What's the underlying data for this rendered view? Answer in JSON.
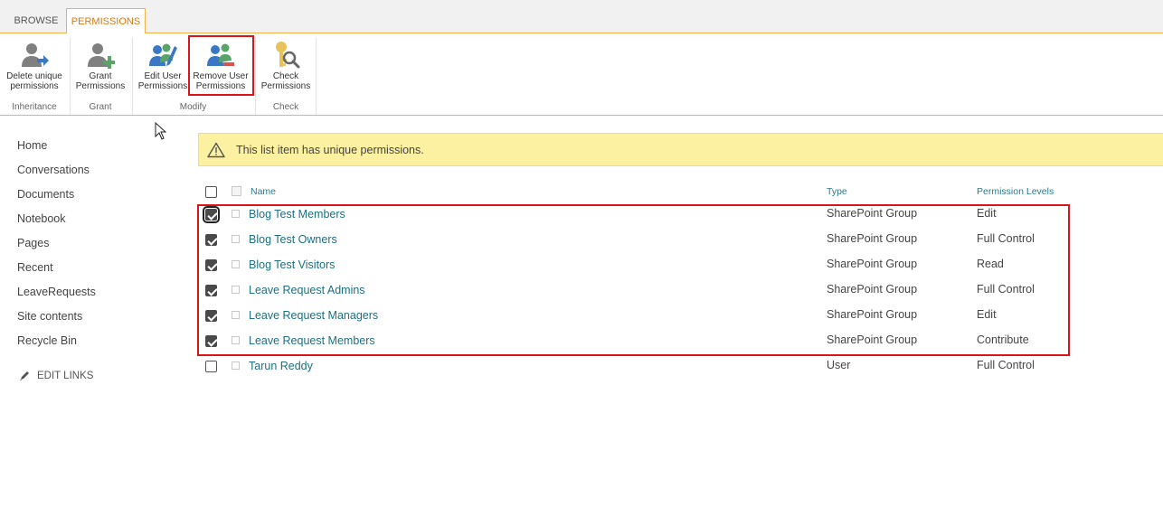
{
  "tabs": [
    {
      "label": "BROWSE",
      "active": false
    },
    {
      "label": "PERMISSIONS",
      "active": true
    }
  ],
  "ribbon": {
    "buttons": {
      "delete_unique": {
        "line1": "Delete unique",
        "line2": "permissions",
        "icon": "user-arrow-icon"
      },
      "grant": {
        "line1": "Grant",
        "line2": "Permissions",
        "icon": "user-add-icon"
      },
      "edit_user": {
        "line1": "Edit User",
        "line2": "Permissions",
        "icon": "users-edit-icon"
      },
      "remove_user": {
        "line1": "Remove User",
        "line2": "Permissions",
        "icon": "users-remove-icon"
      },
      "check": {
        "line1": "Check",
        "line2": "Permissions",
        "icon": "key-search-icon"
      }
    },
    "groups": {
      "inheritance": "Inheritance",
      "grant": "Grant",
      "modify": "Modify",
      "check": "Check"
    }
  },
  "nav": {
    "items": [
      "Home",
      "Conversations",
      "Documents",
      "Notebook",
      "Pages",
      "Recent",
      "LeaveRequests",
      "Site contents",
      "Recycle Bin"
    ],
    "edit_links": "EDIT LINKS"
  },
  "warning": {
    "text": "This list item has unique permissions.",
    "icon": "warning-triangle-icon"
  },
  "table": {
    "headers": {
      "name": "Name",
      "type": "Type",
      "permission_levels": "Permission Levels"
    },
    "rows": [
      {
        "name": "Blog Test Members",
        "type": "SharePoint Group",
        "level": "Edit",
        "checked": true
      },
      {
        "name": "Blog Test Owners",
        "type": "SharePoint Group",
        "level": "Full Control",
        "checked": true
      },
      {
        "name": "Blog Test Visitors",
        "type": "SharePoint Group",
        "level": "Read",
        "checked": true
      },
      {
        "name": "Leave Request Admins",
        "type": "SharePoint Group",
        "level": "Full Control",
        "checked": true
      },
      {
        "name": "Leave Request Managers",
        "type": "SharePoint Group",
        "level": "Edit",
        "checked": true
      },
      {
        "name": "Leave Request Members",
        "type": "SharePoint Group",
        "level": "Contribute",
        "checked": true
      },
      {
        "name": "Tarun Reddy",
        "type": "User",
        "level": "Full Control",
        "checked": false
      }
    ]
  },
  "colors": {
    "accent_orange": "#f0b24a",
    "highlight_red": "#d9141b",
    "link_teal": "#1e6f7f",
    "warning_bg": "#fcf0a1"
  }
}
